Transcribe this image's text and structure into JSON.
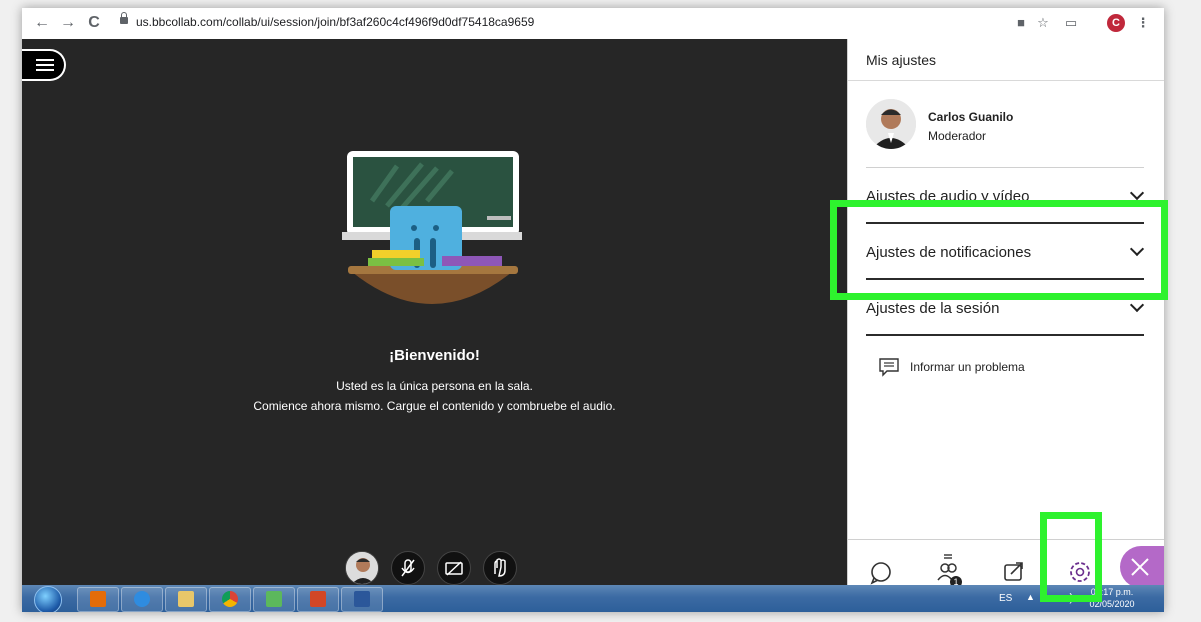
{
  "browser": {
    "url": "us.bbcollab.com/collab/ui/session/join/bf3af260c4cf496f9d0df75418ca9659",
    "profile_initial": "C"
  },
  "stage": {
    "welcome_title": "¡Bienvenido!",
    "welcome_line1": "Usted es la única persona en la sala.",
    "welcome_line2": "Comience ahora mismo. Cargue el contenido y combruebe el audio."
  },
  "panel": {
    "title": "Mis ajustes",
    "user_name": "Carlos Guanilo",
    "user_role": "Moderador",
    "sections": [
      {
        "label": "Ajustes de audio y vídeo"
      },
      {
        "label": "Ajustes de notificaciones"
      },
      {
        "label": "Ajustes de la sesión"
      }
    ],
    "report_label": "Informar un problema",
    "tabs": [
      {
        "icon": "chat-icon"
      },
      {
        "icon": "attendees-icon",
        "badge": "1"
      },
      {
        "icon": "share-icon"
      },
      {
        "icon": "settings-icon"
      }
    ]
  },
  "taskbar": {
    "language": "ES",
    "time": "03:17 p.m.",
    "date": "02/05/2020"
  },
  "colors": {
    "highlight": "#2ef22e",
    "accent": "#6b2f8e",
    "stage_bg": "#262626"
  }
}
